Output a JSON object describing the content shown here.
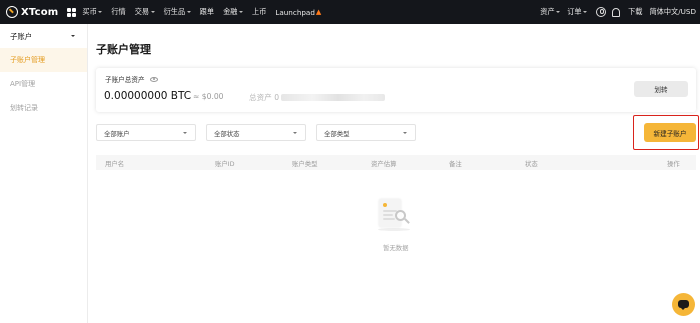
{
  "topnav": {
    "logo_text": "XTcom",
    "items": [
      {
        "label": "买币",
        "has_caret": true
      },
      {
        "label": "行情",
        "has_caret": false
      },
      {
        "label": "交易",
        "has_caret": true
      },
      {
        "label": "衍生品",
        "has_caret": true
      },
      {
        "label": "跟单",
        "has_caret": false
      },
      {
        "label": "金融",
        "has_caret": true
      },
      {
        "label": "上币",
        "has_caret": false
      },
      {
        "label": "Launchpad",
        "has_caret": false
      }
    ],
    "right": {
      "assets": "资产",
      "orders": "订单",
      "download": "下载",
      "language": "简体中文/USD"
    }
  },
  "sidebar": {
    "header": "子账户",
    "items": [
      {
        "label": "子账户管理",
        "active": true
      },
      {
        "label": "API管理",
        "active": false
      },
      {
        "label": "划转记录",
        "active": false
      }
    ]
  },
  "main": {
    "title": "子账户管理",
    "asset_label": "子账户总资产",
    "btc_amount": "0.00000000 BTC",
    "usd_amount": "≈ $0.00",
    "total_asset_label": "总资产 0",
    "transfer_button": "划转",
    "filters": [
      {
        "label": "全部账户"
      },
      {
        "label": "全部状态"
      },
      {
        "label": "全部类型"
      }
    ],
    "create_button": "新建子账户",
    "table_headers": [
      "用户名",
      "账户ID",
      "账户类型",
      "资产估算",
      "备注",
      "状态",
      "操作"
    ],
    "empty_text": "暂无数据"
  },
  "colors": {
    "nav_bg": "#14161b",
    "accent": "#f5b638",
    "accent_text": "#e39a1c",
    "highlight": "#d9231c"
  }
}
